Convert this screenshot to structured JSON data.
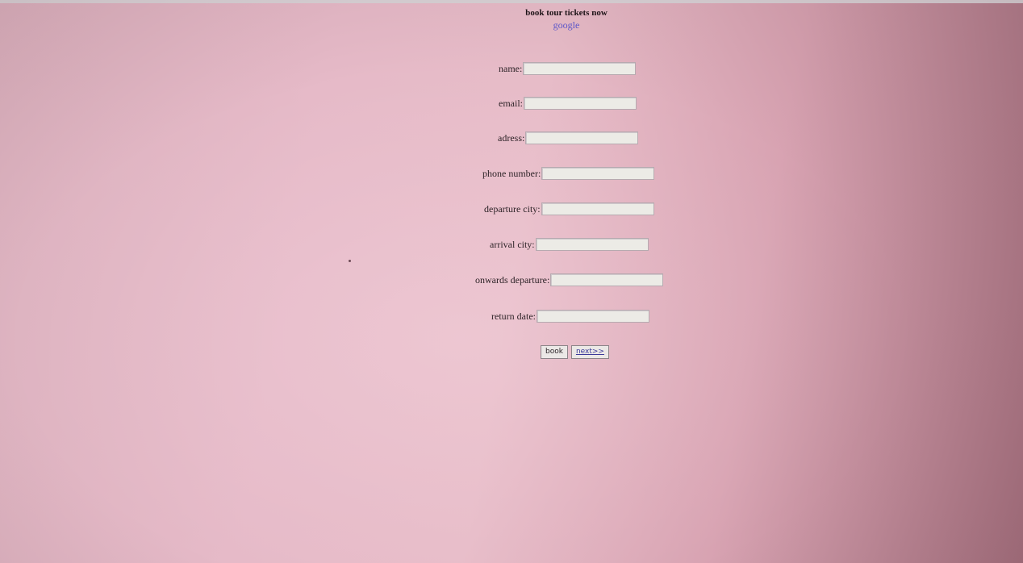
{
  "header": {
    "title": "book tour tickets now",
    "link_label": "google"
  },
  "form": {
    "fields": [
      {
        "label": "name:",
        "value": ""
      },
      {
        "label": "email:",
        "value": ""
      },
      {
        "label": "adress:",
        "value": ""
      },
      {
        "label": "phone number:",
        "value": ""
      },
      {
        "label": "departure city:",
        "value": ""
      },
      {
        "label": "arrival city:",
        "value": ""
      },
      {
        "label": "onwards departure:",
        "value": ""
      },
      {
        "label": "return date:",
        "value": ""
      }
    ],
    "book_label": "book",
    "next_label": "next>>"
  },
  "colors": {
    "background": "#e6bac8",
    "link": "#5a55c8",
    "field_background": "#ecebe6"
  }
}
